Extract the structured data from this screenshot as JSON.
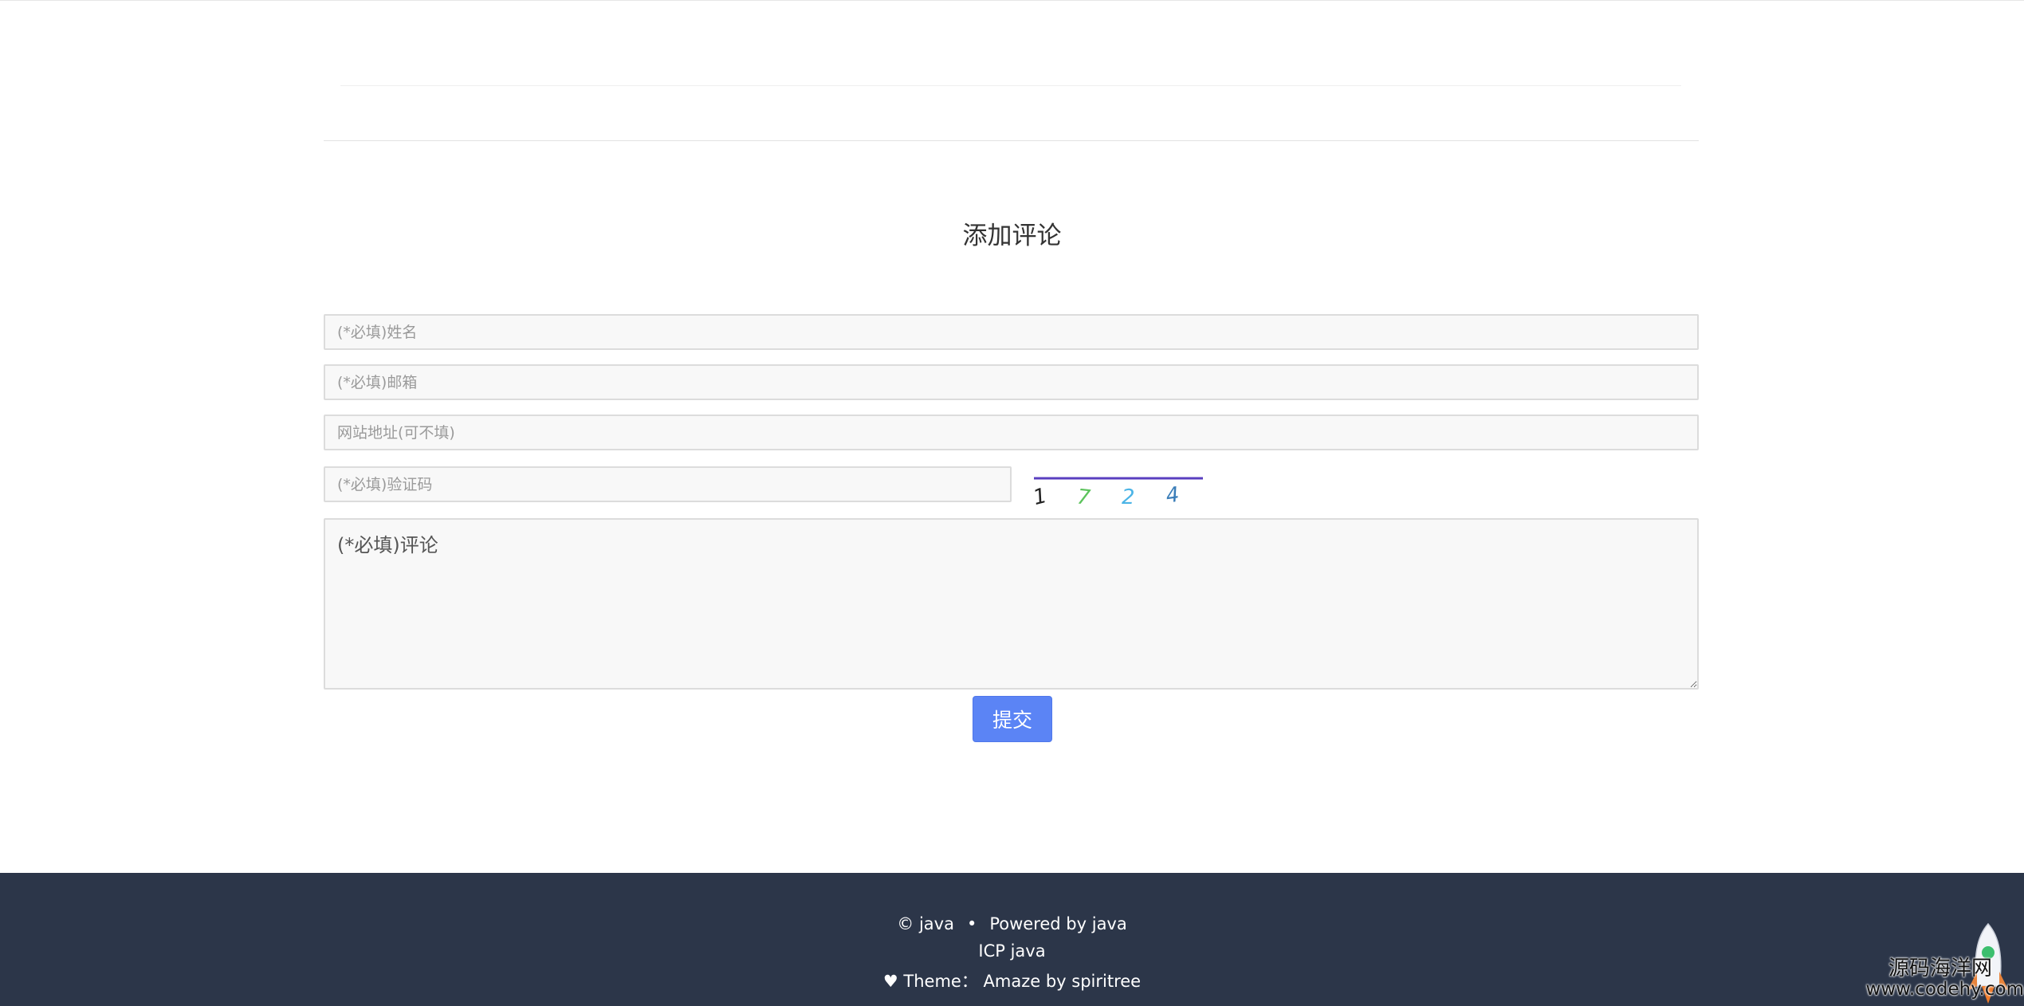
{
  "comment_form": {
    "title": "添加评论",
    "name_placeholder": "(*必填)姓名",
    "email_placeholder": "(*必填)邮箱",
    "website_placeholder": "网站地址(可不填)",
    "captcha_placeholder": "(*必填)验证码",
    "captcha_code": [
      "1",
      "7",
      "2",
      "4"
    ],
    "captcha_colors": [
      "#222222",
      "#5cc35c",
      "#4bb4e6",
      "#3a7db8"
    ],
    "comment_placeholder": "(*必填)评论",
    "submit_label": "提交",
    "accent_color": "#5b84f5"
  },
  "footer": {
    "copyright": "© java",
    "separator": "•",
    "powered_by": "Powered by java",
    "icp": "ICP java",
    "heart": "♥",
    "theme_label": "Theme：",
    "theme_value": "Amaze by spiritree",
    "background": "#2c3649"
  },
  "watermark": {
    "line1": "源码海洋网",
    "line2": "www.codehy.com"
  }
}
